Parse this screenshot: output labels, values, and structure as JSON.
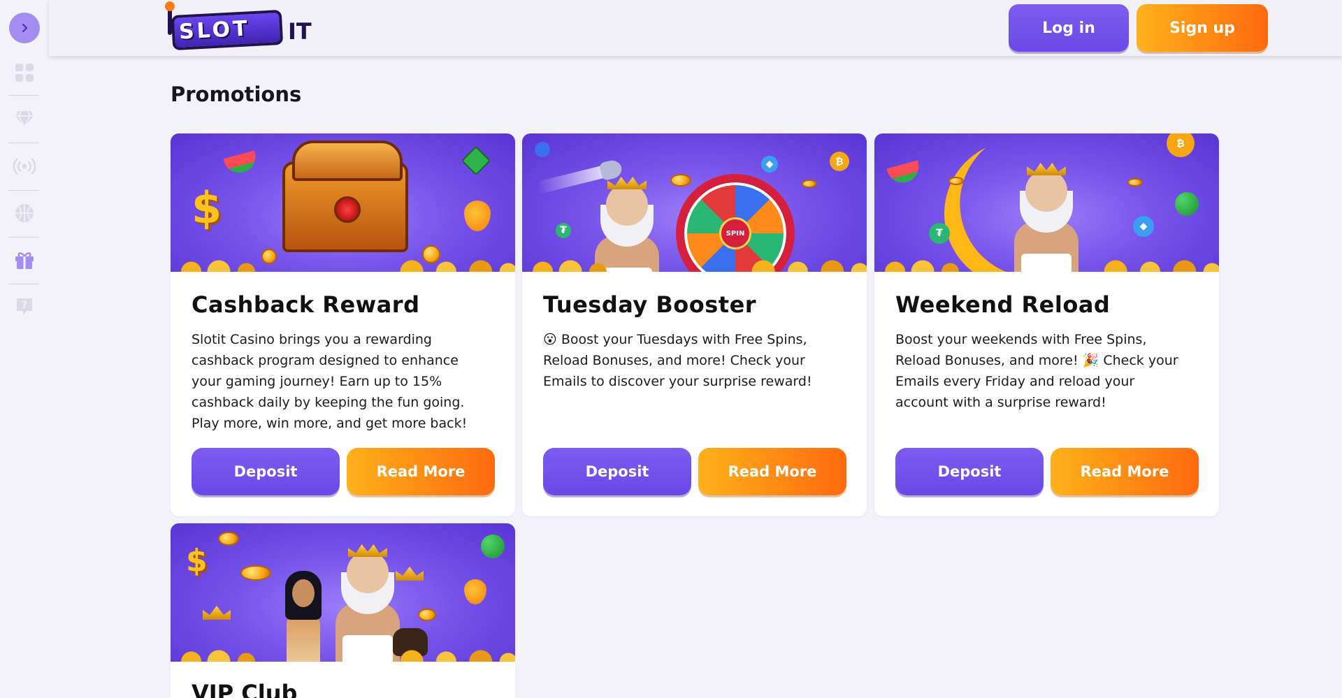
{
  "sidebar": {
    "icons": [
      "chevron-right-icon",
      "grid-icon",
      "diamond-icon",
      "live-broadcast-icon",
      "sports-ball-icon",
      "gift-icon",
      "help-icon"
    ]
  },
  "header": {
    "logo_text": "SLOT",
    "logo_suffix": "IT",
    "login_label": "Log in",
    "signup_label": "Sign up"
  },
  "page": {
    "title": "Promotions"
  },
  "promotions": [
    {
      "title": "Cashback Reward",
      "description": [
        "Slotit Casino brings you a rewarding",
        "cashback program designed to enhance",
        "your gaming journey! Earn up to 15%",
        "cashback daily by keeping the fun going.",
        "Play more, win more, and get more back!"
      ],
      "deposit_label": "Deposit",
      "readmore_label": "Read More"
    },
    {
      "title": "Tuesday Booster",
      "description": [
        "😮 Boost your Tuesdays with Free Spins,",
        "Reload Bonuses, and more! Check your",
        "Emails to discover your surprise reward!"
      ],
      "deposit_label": "Deposit",
      "readmore_label": "Read More"
    },
    {
      "title": "Weekend Reload",
      "description": [
        "Boost your weekends with Free Spins,",
        "Reload Bonuses, and more! 🎉 Check your",
        "Emails every Friday and reload your",
        "account with a surprise reward!"
      ],
      "deposit_label": "Deposit",
      "readmore_label": "Read More"
    },
    {
      "title": "VIP Club"
    }
  ],
  "colors": {
    "purple": "#7353ec",
    "orange": "#ff8a14",
    "background": "#f3f2f8",
    "card": "#ffffff"
  }
}
